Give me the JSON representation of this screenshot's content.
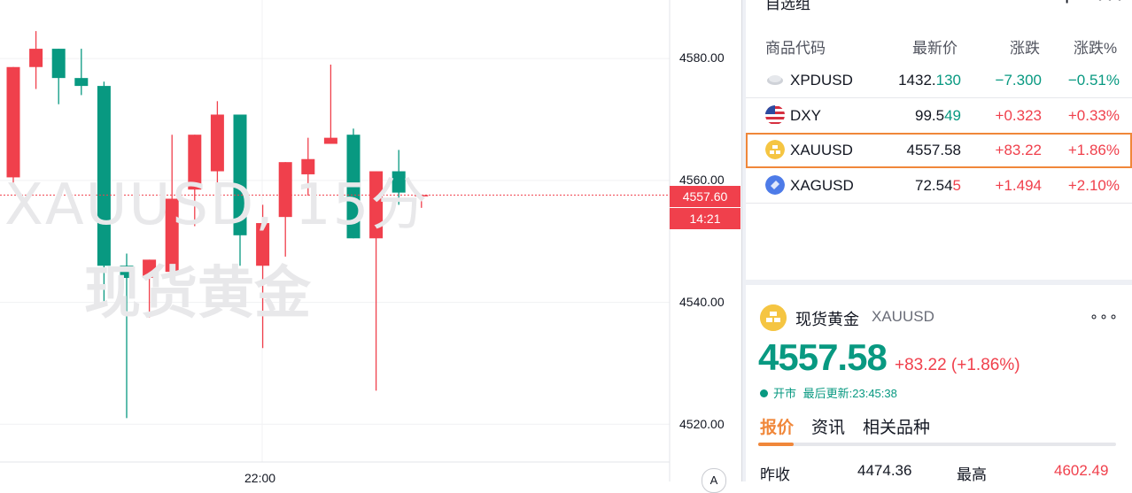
{
  "chart": {
    "watermark_symbol": "XAUUSD, 15分",
    "watermark_name": "现货黄金",
    "y_ticks": [
      "4580.00",
      "4560.00",
      "4540.00",
      "4520.00"
    ],
    "x_ticks": [
      "22:00"
    ],
    "last_price_label": "4557.60",
    "countdown_label": "14:21",
    "badge_label": "A"
  },
  "chart_data": {
    "type": "candlestick",
    "ylim": [
      4513,
      4588
    ],
    "y_ticks": [
      4580,
      4560,
      4540,
      4520
    ],
    "last_price": 4557.6,
    "candles": [
      {
        "o": 4560.5,
        "h": 4578.6,
        "l": 4558.5,
        "c": 4578.6
      },
      {
        "o": 4578.6,
        "h": 4584.5,
        "l": 4575.0,
        "c": 4581.6
      },
      {
        "o": 4581.6,
        "h": 4581.6,
        "l": 4572.5,
        "c": 4576.8
      },
      {
        "o": 4576.8,
        "h": 4581.6,
        "l": 4574.0,
        "c": 4575.5
      },
      {
        "o": 4575.5,
        "h": 4576.2,
        "l": 4540.0,
        "c": 4546.0
      },
      {
        "o": 4546.0,
        "h": 4548.0,
        "l": 4521.0,
        "c": 4544.0
      },
      {
        "o": 4544.0,
        "h": 4547.0,
        "l": 4537.5,
        "c": 4547.0
      },
      {
        "o": 4545.0,
        "h": 4567.5,
        "l": 4543.0,
        "c": 4557.0
      },
      {
        "o": 4558.5,
        "h": 4567.5,
        "l": 4552.5,
        "c": 4567.5
      },
      {
        "o": 4561.5,
        "h": 4573.0,
        "l": 4559.5,
        "c": 4570.8
      },
      {
        "o": 4570.8,
        "h": 4561.2,
        "l": 4546.0,
        "c": 4551.0
      },
      {
        "o": 4546.0,
        "h": 4556.0,
        "l": 4532.5,
        "c": 4553.0
      },
      {
        "o": 4554.0,
        "h": 4563.0,
        "l": 4547.5,
        "c": 4563.0
      },
      {
        "o": 4561.0,
        "h": 4567.0,
        "l": 4557.5,
        "c": 4563.5
      },
      {
        "o": 4566.0,
        "h": 4579.0,
        "l": 4566.0,
        "c": 4567.0
      },
      {
        "o": 4567.5,
        "h": 4568.5,
        "l": 4550.5,
        "c": 4550.5
      },
      {
        "o": 4550.5,
        "h": 4561.5,
        "l": 4525.5,
        "c": 4561.5
      },
      {
        "o": 4561.5,
        "h": 4565.0,
        "l": 4556.0,
        "c": 4558.0
      },
      {
        "o": 4557.6,
        "h": 4557.6,
        "l": 4555.5,
        "c": 4557.6
      }
    ],
    "colors": {
      "up": "#f0404c",
      "down": "#089981"
    }
  },
  "watchlist": {
    "title": "自选组",
    "headers": {
      "symbol": "商品代码",
      "last": "最新价",
      "change": "涨跌",
      "change_pct": "涨跌%"
    },
    "rows": [
      {
        "symbol": "XPDUSD",
        "last_main": "1432.",
        "last_tail": "130",
        "change": "−7.300",
        "change_pct": "−0.51%",
        "dir": "down",
        "icon": "palladium-icon"
      },
      {
        "symbol": "DXY",
        "last_main": "99.5",
        "last_tail": "49",
        "change": "+0.323",
        "change_pct": "+0.33%",
        "dir": "up",
        "icon": "us-flag-icon"
      },
      {
        "symbol": "XAUUSD",
        "last_main": "4557.58",
        "last_tail": "",
        "change": "+83.22",
        "change_pct": "+1.86%",
        "dir": "up",
        "icon": "gold-icon"
      },
      {
        "symbol": "XAGUSD",
        "last_main": "72.54",
        "last_tail": "5",
        "change": "+1.494",
        "change_pct": "+2.10%",
        "dir": "up",
        "icon": "silver-icon"
      }
    ]
  },
  "detail": {
    "name": "现货黄金",
    "symbol": "XAUUSD",
    "price": "4557.58",
    "change": "+83.22 (+1.86%)",
    "status": "开市",
    "updated": "最后更新:23:45:38",
    "tabs": [
      "报价",
      "资讯",
      "相关品种"
    ],
    "prev_close_label": "昨收",
    "prev_close": "4474.36",
    "high_label": "最高",
    "high": "4602.49"
  }
}
